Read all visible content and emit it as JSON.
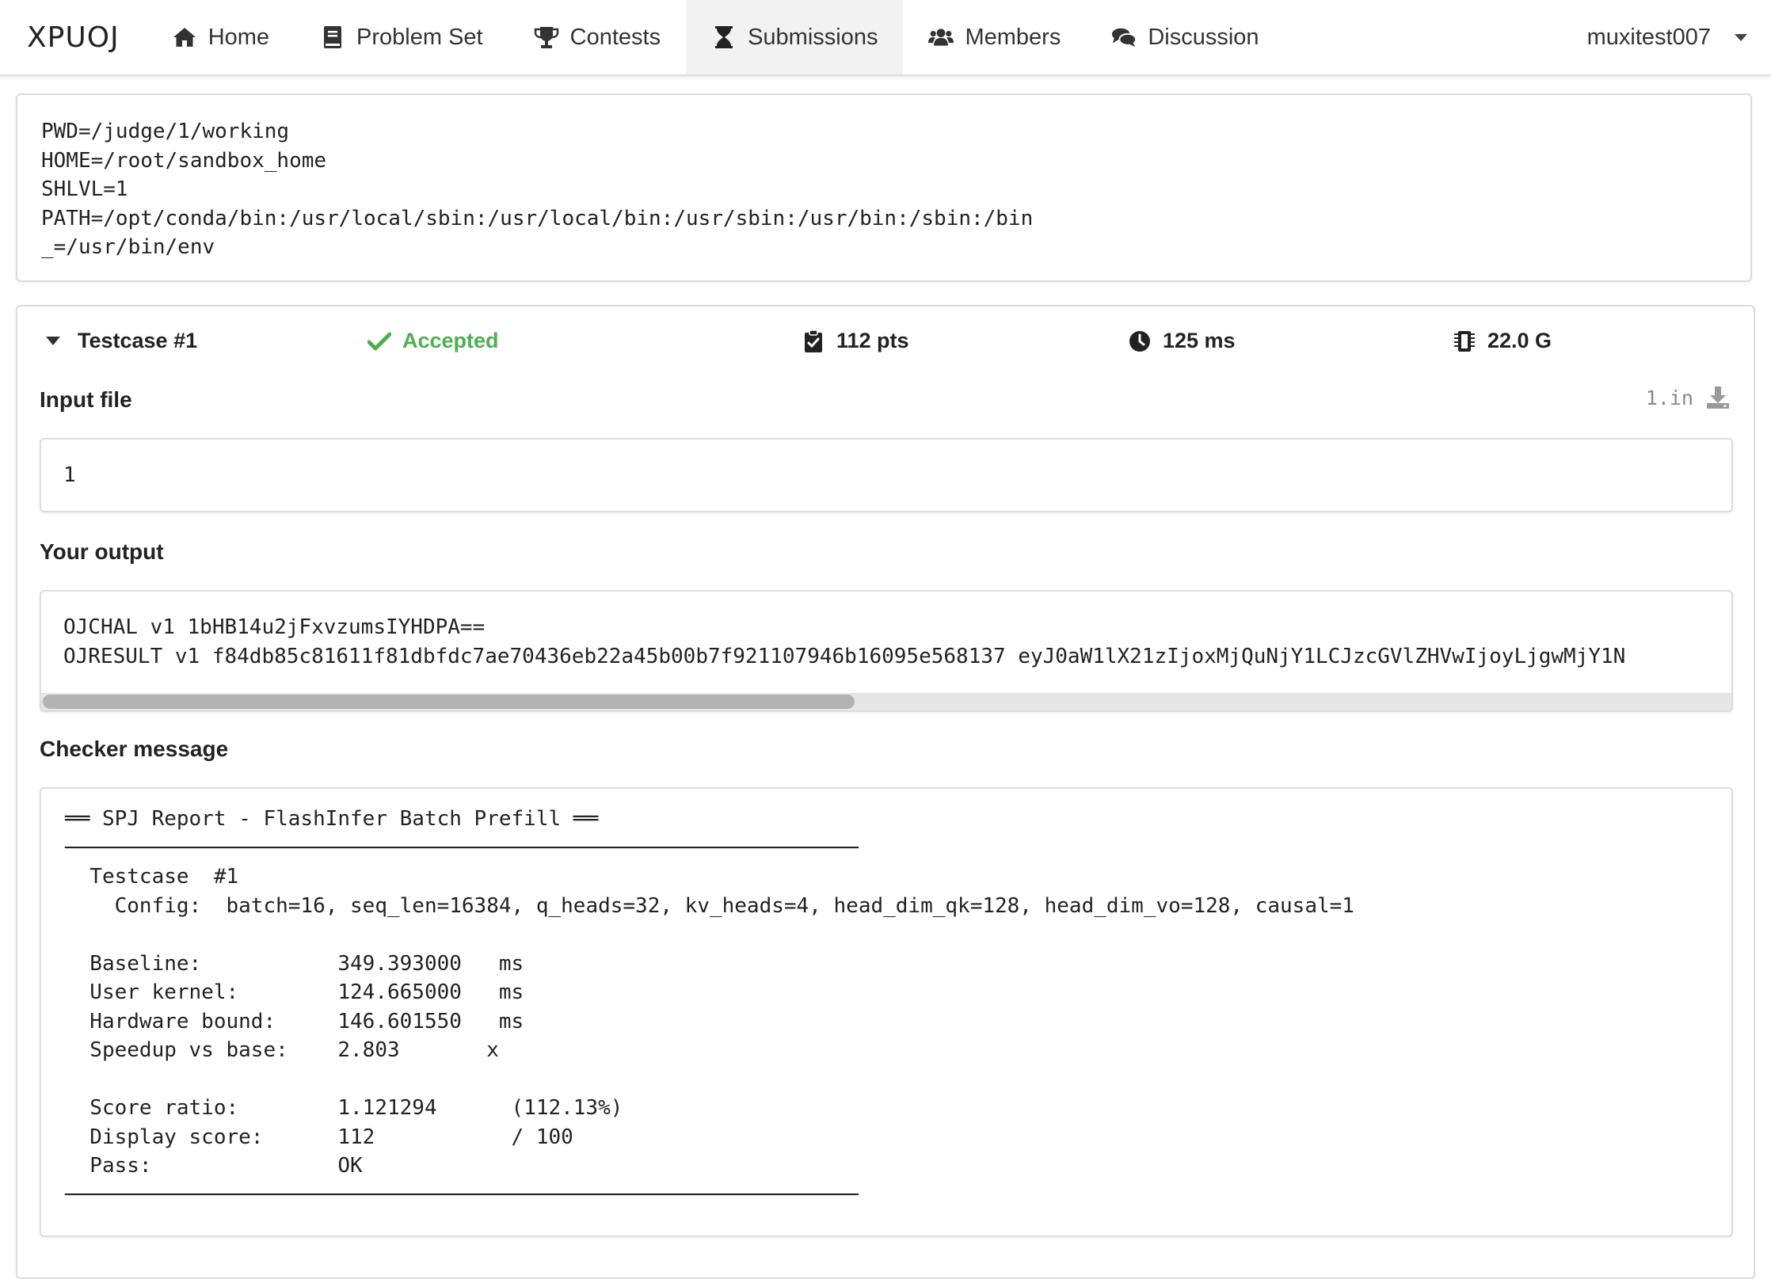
{
  "brand": "XPUOJ",
  "nav": {
    "home": "Home",
    "problem_set": "Problem Set",
    "contests": "Contests",
    "submissions": "Submissions",
    "members": "Members",
    "discussion": "Discussion",
    "active": "submissions"
  },
  "user": {
    "name": "muxitest007"
  },
  "env_output": "PWD=/judge/1/working\nHOME=/root/sandbox_home\nSHLVL=1\nPATH=/opt/conda/bin:/usr/local/sbin:/usr/local/bin:/usr/sbin:/usr/bin:/sbin:/bin\n_=/usr/bin/env",
  "testcase": {
    "title": "Testcase #1",
    "status": "Accepted",
    "score": "112 pts",
    "time": "125 ms",
    "memory": "22.0 G",
    "status_color": "#4caf50"
  },
  "input_section": {
    "label": "Input file",
    "file_name": "1.in",
    "content": "1"
  },
  "output_section": {
    "label": "Your output",
    "content": "OJCHAL v1 1bHB14u2jFxvzumsIYHDPA==\nOJRESULT v1 f84db85c81611f81dbfdc7ae70436eb22a45b00b7f921107946b16095e568137 eyJ0aW1lX21zIjoxMjQuNjY1LCJzcGVlZHVwIjoyLjgwMjY1N",
    "scroll_position": 0.48
  },
  "checker_section": {
    "label": "Checker message",
    "content": "══ SPJ Report - FlashInfer Batch Prefill ══\n────────────────────────────────────────────────────────────────\n  Testcase  #1\n    Config:  batch=16, seq_len=16384, q_heads=32, kv_heads=4, head_dim_qk=128, head_dim_vo=128, causal=1\n\n  Baseline:           349.393000   ms\n  User kernel:        124.665000   ms\n  Hardware bound:     146.601550   ms\n  Speedup vs base:    2.803       x\n\n  Score ratio:        1.121294      (112.13%)\n  Display score:      112           / 100\n  Pass:               OK\n────────────────────────────────────────────────────────────────"
  },
  "icons": {
    "home": "home-icon",
    "problem_set": "book-icon",
    "contests": "trophy-icon",
    "submissions": "hourglass-icon",
    "members": "users-icon",
    "discussion": "comments-icon",
    "status": "check-icon",
    "score": "clipboard-check-icon",
    "time": "clock-icon",
    "memory": "microchip-icon",
    "download": "download-icon"
  }
}
